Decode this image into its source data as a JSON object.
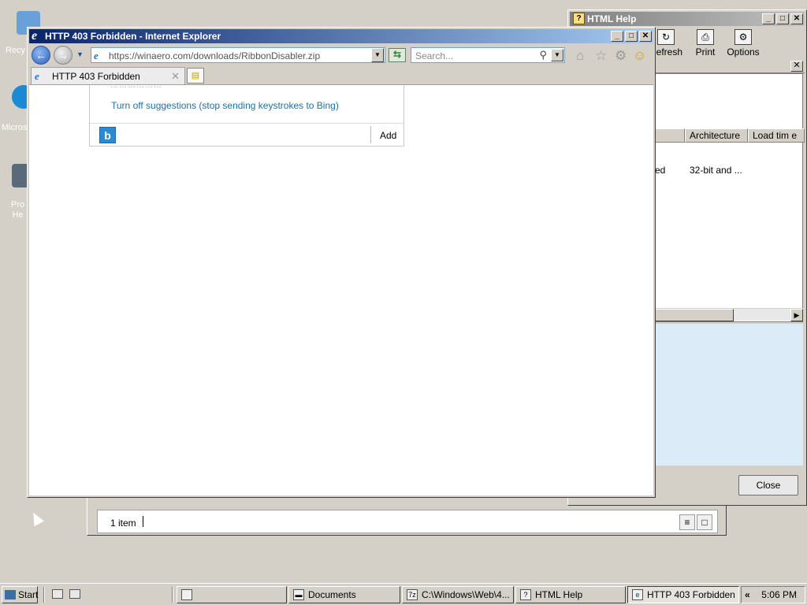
{
  "desktop": {
    "icons": [
      {
        "name": "recycle-bin-icon",
        "label": "Recy"
      },
      {
        "name": "edge-icon",
        "label": "Micros"
      },
      {
        "name": "program-icon",
        "label": "Pro\nHe"
      }
    ]
  },
  "help_window": {
    "title": "HTML Help",
    "toolbar": {
      "refresh": "Refresh",
      "print": "Print",
      "options": "Options"
    },
    "columns": [
      "Architecture",
      "Load tim e"
    ],
    "row": {
      "cell_partial": "ed",
      "architecture": "32-bit and ..."
    },
    "close_label": "Close"
  },
  "ie_window": {
    "title": "HTTP 403 Forbidden - Internet Explorer",
    "address": "https://winaero.com/downloads/RibbonDisabler.zip",
    "search_placeholder": "Search...",
    "tab_title": "HTTP 403 Forbidden",
    "suggestions": {
      "cut_text": "………………",
      "link": "Turn off suggestions (stop sending keystrokes to Bing)",
      "bing_logo": "b",
      "add_label": "Add"
    }
  },
  "explorer_window": {
    "status": "1 item"
  },
  "taskbar": {
    "start": "Start",
    "buttons": [
      {
        "label": ""
      },
      {
        "label": "Documents"
      },
      {
        "label": "C:\\Windows\\Web\\4..."
      },
      {
        "label": "HTML Help"
      },
      {
        "label": "HTTP 403 Forbidden ..."
      }
    ],
    "chevron": "«",
    "clock": "5:06 PM"
  },
  "colors": {
    "desktop_bg": "#d4d0c8",
    "ie_title_active": "#0a246a",
    "help_title_inactive": "#808080",
    "link": "#1f6fa8"
  }
}
